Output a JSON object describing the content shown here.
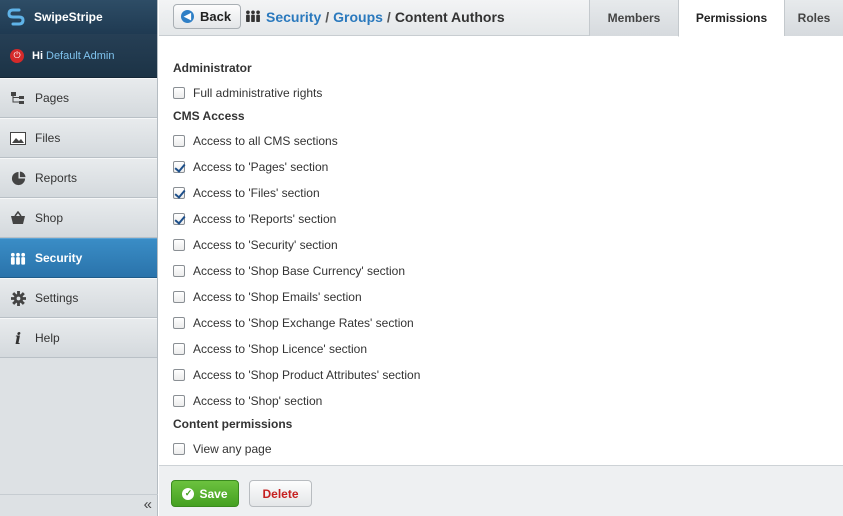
{
  "app": {
    "brand": "SwipeStripe"
  },
  "user": {
    "greeting": "Hi",
    "name": "Default Admin"
  },
  "sidebar": {
    "items": [
      {
        "label": "Pages",
        "icon": "sitemap-icon"
      },
      {
        "label": "Files",
        "icon": "image-icon"
      },
      {
        "label": "Reports",
        "icon": "pie-chart-icon"
      },
      {
        "label": "Shop",
        "icon": "basket-icon"
      },
      {
        "label": "Security",
        "icon": "people-icon",
        "active": true
      },
      {
        "label": "Settings",
        "icon": "gear-icon"
      },
      {
        "label": "Help",
        "icon": "info-icon"
      }
    ],
    "collapse_label": "«"
  },
  "header": {
    "back_label": "Back",
    "breadcrumb": {
      "security": "Security",
      "groups": "Groups",
      "current": "Content Authors",
      "separator": "/"
    }
  },
  "tabs": [
    {
      "label": "Members"
    },
    {
      "label": "Permissions",
      "active": true
    },
    {
      "label": "Roles"
    }
  ],
  "sections": {
    "administrator": {
      "title": "Administrator",
      "items": [
        {
          "label": "Full administrative rights",
          "checked": false
        }
      ]
    },
    "cms_access": {
      "title": "CMS Access",
      "items": [
        {
          "label": "Access to all CMS sections",
          "checked": false
        },
        {
          "label": "Access to 'Pages' section",
          "checked": true
        },
        {
          "label": "Access to 'Files' section",
          "checked": true
        },
        {
          "label": "Access to 'Reports' section",
          "checked": true
        },
        {
          "label": "Access to 'Security' section",
          "checked": false
        },
        {
          "label": "Access to 'Shop Base Currency' section",
          "checked": false
        },
        {
          "label": "Access to 'Shop Emails' section",
          "checked": false
        },
        {
          "label": "Access to 'Shop Exchange Rates' section",
          "checked": false
        },
        {
          "label": "Access to 'Shop Licence' section",
          "checked": false
        },
        {
          "label": "Access to 'Shop Product Attributes' section",
          "checked": false
        },
        {
          "label": "Access to 'Shop' section",
          "checked": false
        }
      ]
    },
    "content_permissions": {
      "title": "Content permissions",
      "items": [
        {
          "label": "View any page",
          "checked": false
        }
      ]
    }
  },
  "footer": {
    "save_label": "Save",
    "delete_label": "Delete"
  },
  "colors": {
    "accent": "#2a79bd",
    "save": "#45a021",
    "delete": "#c62020",
    "power": "#d42a2a"
  }
}
